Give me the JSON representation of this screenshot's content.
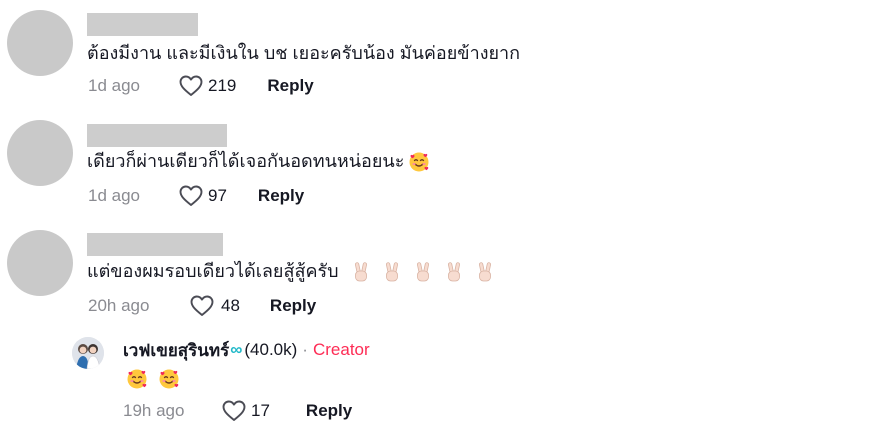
{
  "comments": [
    {
      "text": "ต้องมีงาน และมีเงินใน บช เยอะครับน้อง มันค่อยข้างยาก",
      "time": "1d ago",
      "likes": "219",
      "reply_label": "Reply"
    },
    {
      "text": "เดียวก็ผ่านเดียวก็ได้เจอกันอดทนหน่อยนะ",
      "time": "1d ago",
      "likes": "97",
      "reply_label": "Reply",
      "emojis": [
        "smiling-face-with-hearts"
      ]
    },
    {
      "text": "แต่ของผมรอบเดียวได้เลยสู้สู้ครับ",
      "time": "20h ago",
      "likes": "48",
      "reply_label": "Reply",
      "emojis": [
        "victory-hand",
        "victory-hand",
        "victory-hand",
        "victory-hand",
        "victory-hand"
      ]
    }
  ],
  "creator_reply": {
    "name": "เวฟเขยสุรินทร์",
    "verified_symbol": "∞",
    "follower_count": "(40.0k)",
    "separator": "·",
    "tag": "Creator",
    "emojis": [
      "smiling-face-with-hearts",
      "smiling-face-with-hearts"
    ],
    "time": "19h ago",
    "likes": "17",
    "reply_label": "Reply"
  },
  "colors": {
    "text": "#161823",
    "muted": "#8a8b91",
    "creator_tag": "#fe2c55",
    "verified": "#20b8c8",
    "avatar_placeholder": "#c9c9c9"
  }
}
